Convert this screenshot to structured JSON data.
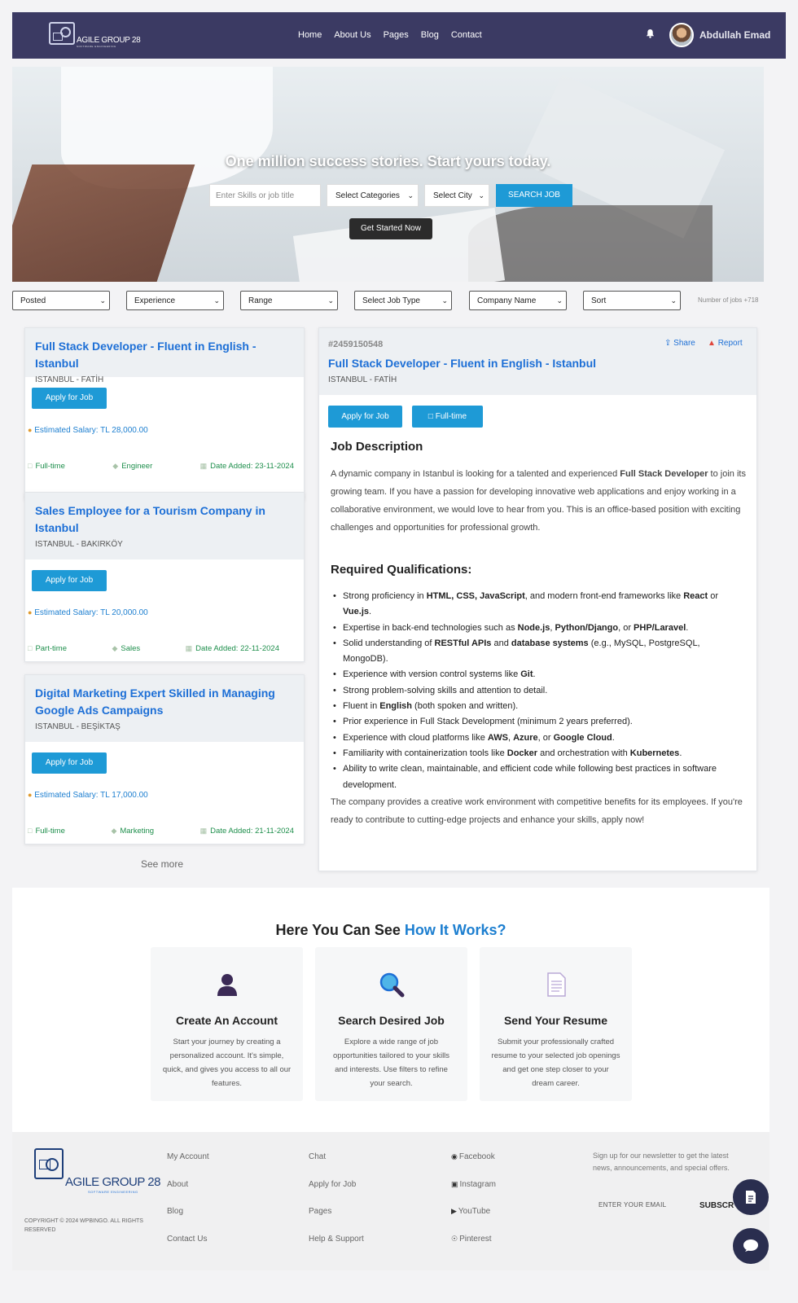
{
  "nav": {
    "logo_text": "AGILE GROUP 28",
    "logo_sub": "SOFTWARE ENGINEERING",
    "menu": [
      "Home",
      "About Us",
      "Pages",
      "Blog",
      "Contact"
    ],
    "username": "Abdullah Emad",
    "bg_color": "#3b3a63"
  },
  "hero": {
    "title": "One million success stories. Start yours today.",
    "search_placeholder": "Enter Skills or job title",
    "category_select": "Select Categories",
    "city_select": "Select City",
    "search_button": "SEARCH JOB",
    "start_button": "Get Started Now"
  },
  "filters": {
    "items": [
      "Posted",
      "Experience",
      "Range",
      "Select Job Type",
      "Company Name",
      "Sort"
    ],
    "count_text": "Number of jobs +718"
  },
  "jobs": [
    {
      "title": "Full Stack Developer - Fluent in English - Istanbul",
      "location": "ISTANBUL - FATİH",
      "apply": "Apply for Job",
      "salary": "Estimated Salary: TL 28,000.00",
      "type": "Full-time",
      "category": "Engineer",
      "date": "Date Added: 23-11-2024"
    },
    {
      "title": "Sales Employee for a Tourism Company in Istanbul",
      "location": "ISTANBUL - BAKIRKÖY",
      "apply": "Apply for Job",
      "salary": "Estimated Salary: TL 20,000.00",
      "type": "Part-time",
      "category": "Sales",
      "date": "Date Added: 22-11-2024"
    },
    {
      "title": "Digital Marketing Expert Skilled in Managing Google Ads Campaigns",
      "location": "ISTANBUL - BEŞİKTAŞ",
      "apply": "Apply for Job",
      "salary": "Estimated Salary: TL 17,000.00",
      "type": "Full-time",
      "category": "Marketing",
      "date": "Date Added: 21-11-2024"
    }
  ],
  "see_more": "See more",
  "detail": {
    "id": "#2459150548",
    "title": "Full Stack Developer - Fluent in English - Istanbul",
    "location": "ISTANBUL - FATİH",
    "share": "Share",
    "report": "Report",
    "apply": "Apply for Job",
    "type": "Full-time",
    "desc_heading": "Job Description",
    "desc_parts": [
      "A dynamic company in Istanbul is looking for a talented and experienced ",
      "Full Stack Developer",
      " to join its growing team. If you have a passion for developing innovative web applications and enjoy working in a collaborative environment, we would love to hear from you. This is an office-based position with exciting challenges and opportunities for professional growth."
    ],
    "qual_heading": "Required Qualifications:",
    "qualifications": [
      [
        "Strong proficiency in ",
        "HTML, CSS, JavaScript",
        ", and modern front-end frameworks like ",
        "React",
        " or ",
        "Vue.js",
        "."
      ],
      [
        "Expertise in back-end technologies such as ",
        "Node.js",
        ", ",
        "Python/Django",
        ", or ",
        "PHP/Laravel",
        "."
      ],
      [
        "Solid understanding of ",
        "RESTful APIs",
        " and ",
        "database systems",
        " (e.g., MySQL, PostgreSQL, MongoDB)."
      ],
      [
        "Experience with version control systems like ",
        "Git",
        "."
      ],
      [
        "Strong problem-solving skills and attention to detail."
      ],
      [
        "Fluent in ",
        "English",
        " (both spoken and written)."
      ],
      [
        "Prior experience in Full Stack Development (minimum 2 years preferred)."
      ],
      [
        "Experience with cloud platforms like ",
        "AWS",
        ", ",
        "Azure",
        ", or ",
        "Google Cloud",
        "."
      ],
      [
        "Familiarity with containerization tools like ",
        "Docker",
        " and orchestration with ",
        "Kubernetes",
        "."
      ],
      [
        "Ability to write clean, maintainable, and efficient code while following best practices in software development."
      ]
    ],
    "closing": "The company provides a creative work environment with competitive benefits for its employees. If you're ready to contribute to cutting-edge projects and enhance your skills, apply now!"
  },
  "how": {
    "title_prefix": "Here You Can See ",
    "title_highlight": "How It Works?",
    "steps": [
      {
        "icon": "user-icon",
        "title": "Create An Account",
        "text": "Start your journey by creating a personalized account. It's simple, quick, and gives you access to all our features."
      },
      {
        "icon": "magnifier-icon",
        "title": "Search Desired Job",
        "text": "Explore a wide range of job opportunities tailored to your skills and interests. Use filters to refine your search."
      },
      {
        "icon": "document-icon",
        "title": "Send Your Resume",
        "text": "Submit your professionally crafted resume to your selected job openings and get one step closer to your dream career."
      }
    ]
  },
  "footer": {
    "logo_text": "AGILE GROUP 28",
    "logo_sub": "SOFTWARE ENGINEERING",
    "copyright": "COPYRIGHT © 2024 WPBINGO. ALL RIGHTS RESERVED",
    "col1": [
      "My Account",
      "About",
      "Blog",
      "Contact Us"
    ],
    "col2": [
      "Chat",
      "Apply for Job",
      "Pages",
      "Help & Support"
    ],
    "col3": [
      "Facebook",
      "Instagram",
      "YouTube",
      "Pinterest"
    ],
    "newsletter": "Sign up for our newsletter to get the latest news, announcements, and special offers.",
    "email_placeholder": "ENTER YOUR EMAIL",
    "subscribe": "SUBSCR"
  },
  "colors": {
    "accent": "#1e9ad6",
    "link": "#1d6fd6",
    "footer_bg": "#f0f0f1"
  }
}
